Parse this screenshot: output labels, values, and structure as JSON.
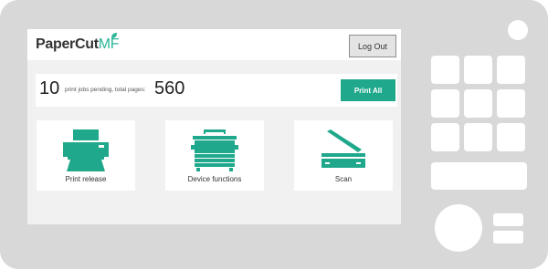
{
  "app": {
    "logo_main": "PaperCut",
    "logo_suffix": "MF",
    "logout_label": "Log Out"
  },
  "summary": {
    "jobs_pending": "10",
    "jobs_text": "print jobs pending, total pages:",
    "total_pages": "560",
    "print_all_label": "Print All"
  },
  "tiles": [
    {
      "label": "Print release",
      "icon": "printer-icon"
    },
    {
      "label": "Device functions",
      "icon": "copier-icon"
    },
    {
      "label": "Scan",
      "icon": "scanner-icon"
    }
  ],
  "colors": {
    "accent": "#1fa88b",
    "device_body": "#d8d8d8",
    "screen_bg": "#f1f1f1"
  }
}
